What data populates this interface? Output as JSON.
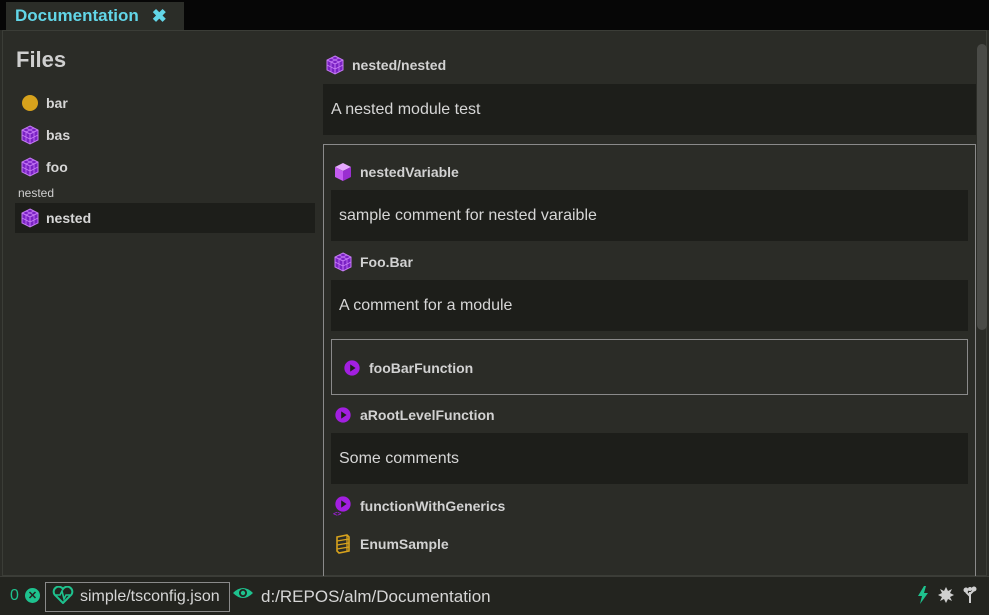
{
  "tab": {
    "title": "Documentation",
    "close_glyph": "✖"
  },
  "sidebar": {
    "title": "Files",
    "items": [
      {
        "label": "bar",
        "icon": "circle-icon"
      },
      {
        "label": "bas",
        "icon": "module-icon"
      },
      {
        "label": "foo",
        "icon": "module-icon"
      }
    ],
    "folder_label": "nested",
    "nested_items": [
      {
        "label": "nested",
        "icon": "module-icon",
        "selected": true
      }
    ]
  },
  "content": {
    "module_name": "nested/nested",
    "module_comment": "A nested module test",
    "symbols": {
      "nested_variable": {
        "name": "nestedVariable",
        "comment": "sample comment for nested varaible"
      },
      "foo_bar": {
        "name": "Foo.Bar",
        "comment": "A comment for a module"
      },
      "foo_bar_function": {
        "name": "fooBarFunction"
      },
      "root_function": {
        "name": "aRootLevelFunction",
        "comment": "Some comments"
      },
      "generic_function": {
        "name": "functionWithGenerics"
      },
      "enum_sample": {
        "name": "EnumSample"
      }
    }
  },
  "statusbar": {
    "error_count": "0",
    "project": "simple/tsconfig.json",
    "path": "d:/REPOS/alm/Documentation"
  },
  "colors": {
    "accent_cyan": "#62d6e8",
    "accent_green": "#1ec28e",
    "module_purple": "#a040e0",
    "variable_purple": "#c65cf2",
    "enum_gold": "#d7a21c"
  }
}
